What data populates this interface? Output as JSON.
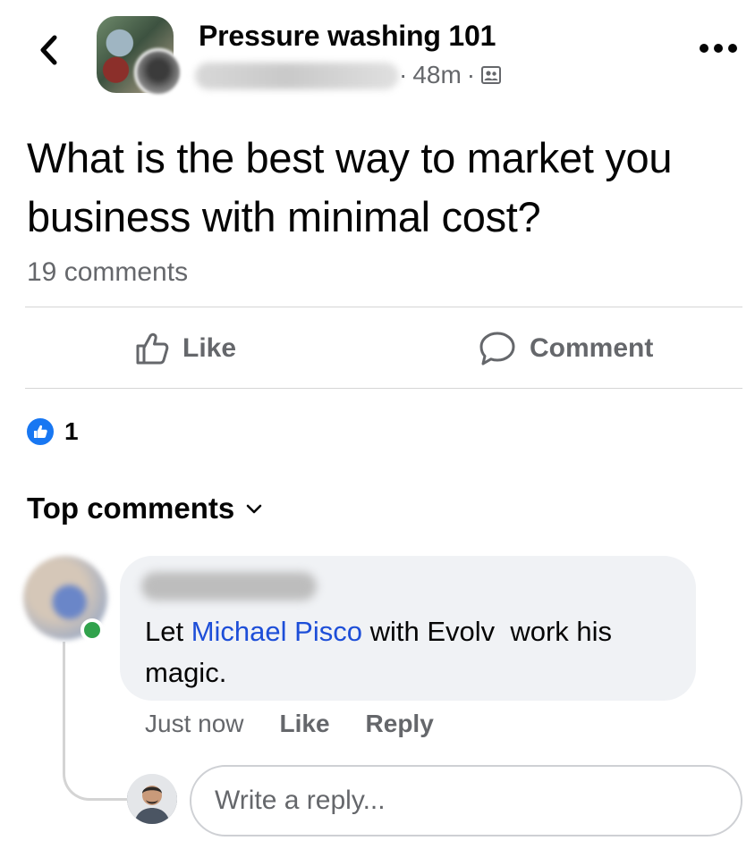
{
  "header": {
    "group_name": "Pressure washing 101",
    "time": "48m",
    "separator": "·",
    "icons": {
      "back": "chevron-left-icon",
      "more": "more-dots-icon",
      "privacy": "group-members-icon"
    }
  },
  "post": {
    "text": "What is the best way to market you business with minimal cost?",
    "comment_count": "19 comments"
  },
  "actions": {
    "like_label": "Like",
    "comment_label": "Comment"
  },
  "reactions": {
    "count": "1",
    "type": "like"
  },
  "comments_section": {
    "sort_label": "Top comments"
  },
  "comment": {
    "text_before": "Let ",
    "mention": "Michael Pisco",
    "text_after": " with Evolv  work his magic.",
    "timestamp": "Just now",
    "like_label": "Like",
    "reply_label": "Reply",
    "online": true
  },
  "reply_box": {
    "placeholder": "Write a reply..."
  },
  "colors": {
    "accent": "#1877f2",
    "mention": "#1d4ed8",
    "online": "#31a24c",
    "secondary_text": "#65676b",
    "bubble": "#f0f2f5"
  }
}
